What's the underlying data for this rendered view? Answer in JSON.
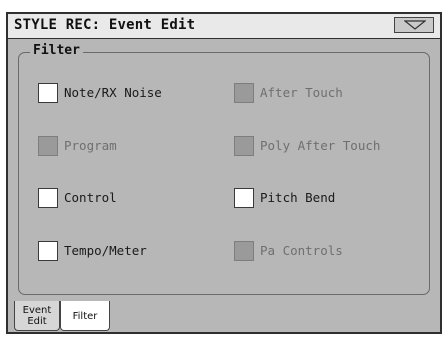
{
  "window": {
    "title": "STYLE REC: Event Edit",
    "menu_icon": "triangle-down-icon"
  },
  "filter": {
    "label": "Filter",
    "items": [
      {
        "label": "Note/RX Noise",
        "checked": false,
        "enabled": true
      },
      {
        "label": "After Touch",
        "checked": false,
        "enabled": false
      },
      {
        "label": "Program",
        "checked": false,
        "enabled": false
      },
      {
        "label": "Poly After Touch",
        "checked": false,
        "enabled": false
      },
      {
        "label": "Control",
        "checked": false,
        "enabled": true
      },
      {
        "label": "Pitch Bend",
        "checked": false,
        "enabled": true
      },
      {
        "label": "Tempo/Meter",
        "checked": false,
        "enabled": true
      },
      {
        "label": "Pa Controls",
        "checked": false,
        "enabled": false
      }
    ]
  },
  "tabs": [
    {
      "label_line1": "Event",
      "label_line2": "Edit",
      "active": false
    },
    {
      "label_line1": "Filter",
      "label_line2": "",
      "active": true
    }
  ],
  "colors": {
    "background": "#b7b7b7",
    "title_bar": "#e9e9e9",
    "checkbox_enabled": "#ffffff",
    "checkbox_disabled": "#9a9a9a"
  }
}
